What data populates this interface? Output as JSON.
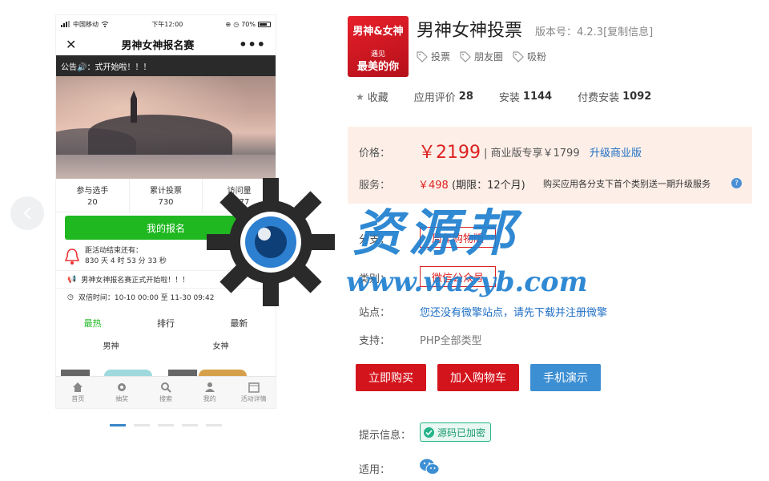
{
  "phone": {
    "status": {
      "carrier": "中国移动",
      "time": "下午12:00",
      "battery": "70%"
    },
    "nav_title": "男神女神报名赛",
    "notice": "公告🔊：式开始啦！！！",
    "stats": [
      {
        "label": "参与选手",
        "value": "20"
      },
      {
        "label": "累计投票",
        "value": "730"
      },
      {
        "label": "访问量",
        "value": "1077"
      }
    ],
    "signup_button": "我的报名",
    "countdown_title": "距活动结束还有：",
    "countdown_value": "830 天 4 时 53 分 33 秒",
    "announcement": "男神女神报名赛正式开始啦！！！",
    "vote_time": "双倍时间：10-10 00:00 至 11-30 09:42",
    "tabs": [
      "最热",
      "排行",
      "最新"
    ],
    "genders": [
      "男神",
      "女神"
    ],
    "tabbar": [
      "首页",
      "抽奖",
      "搜索",
      "我的",
      "活动详情"
    ]
  },
  "watermark": {
    "text": "资源邦",
    "url": "www.wazyb.com"
  },
  "product": {
    "icon_title": "男神&女神",
    "icon_sub1": "遇见",
    "icon_sub2": "最美的你",
    "title": "男神女神投票",
    "version": "版本号：4.2.3[复制信息]",
    "tags": [
      "投票",
      "朋友圈",
      "吸粉"
    ],
    "favorite": "收藏",
    "rating_label": "应用评价",
    "rating_value": "28",
    "install_label": "安装",
    "install_value": "1144",
    "paid_install_label": "付费安装",
    "paid_install_value": "1092",
    "price_label": "价格：",
    "price": "￥2199",
    "pro_price": "| 商业版专享￥1799",
    "upgrade_link": "升级商业版",
    "service_label": "服务：",
    "service_price": "￥498",
    "service_term": "(期限：12个月)",
    "service_note": "购买应用各分支下首个类别送一期升级服务",
    "help_icon": "?",
    "branch_label": "分支：",
    "branch_value": "周年购物版",
    "category_label": "类别：",
    "category_value": "微信公众号",
    "site_label": "站点：",
    "site_text": "您还没有微擎站点，请先下载并注册微擎",
    "support_label": "支持：",
    "support_text": "PHP全部类型",
    "buy_button": "立即购买",
    "cart_button": "加入购物车",
    "demo_button": "手机演示",
    "hint_label": "提示信息：",
    "encrypted_text": "源码已加密",
    "apply_label": "适用："
  },
  "colors": {
    "accent_red": "#d4141c",
    "blue": "#3d8fd3",
    "green": "#1fb821",
    "price_bg": "#fdefe7"
  }
}
